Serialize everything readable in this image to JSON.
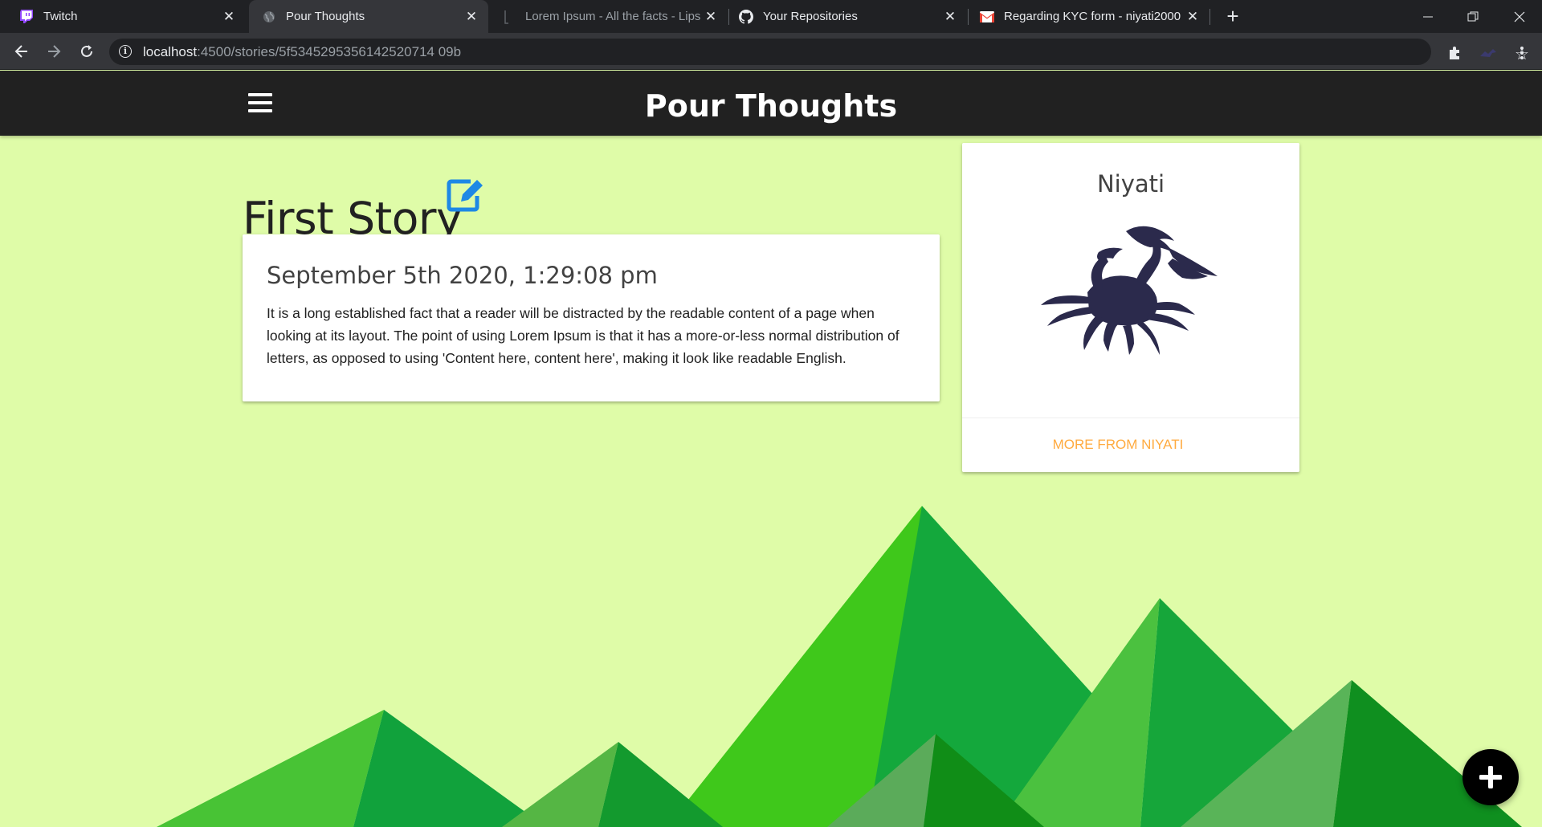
{
  "browser": {
    "tabs": [
      {
        "title": "Twitch",
        "icon": "twitch-icon",
        "active": false
      },
      {
        "title": "Pour Thoughts",
        "icon": "globe-icon",
        "active": true
      },
      {
        "title": "Lorem Ipsum - All the facts - Lipsum",
        "icon": "page-icon",
        "active": false
      },
      {
        "title": "Your Repositories",
        "icon": "github-icon",
        "active": false
      },
      {
        "title": "Regarding KYC form - niyati2000",
        "icon": "gmail-icon",
        "active": false
      }
    ],
    "url_host": "localhost",
    "url_rest": ":4500/stories/5f5345295356142520714 09b"
  },
  "app": {
    "brand": "Pour Thoughts"
  },
  "story": {
    "title": "First Story",
    "date": "September 5th 2020, 1:29:08 pm",
    "body": "It is a long established fact that a reader will be distracted by the readable content of a page when looking at its layout. The point of using Lorem Ipsum is that it has a more-or-less normal distribution of letters, as opposed to using 'Content here, content here', making it look like readable English."
  },
  "author": {
    "name": "Niyati",
    "more_link": "More from Niyati",
    "avatar_icon": "crab-icon"
  },
  "colors": {
    "background": "#dffca8",
    "appbar": "#212121",
    "edit_icon": "#1e88e5",
    "link": "#ffab40",
    "avatar": "#2b2a4c"
  }
}
